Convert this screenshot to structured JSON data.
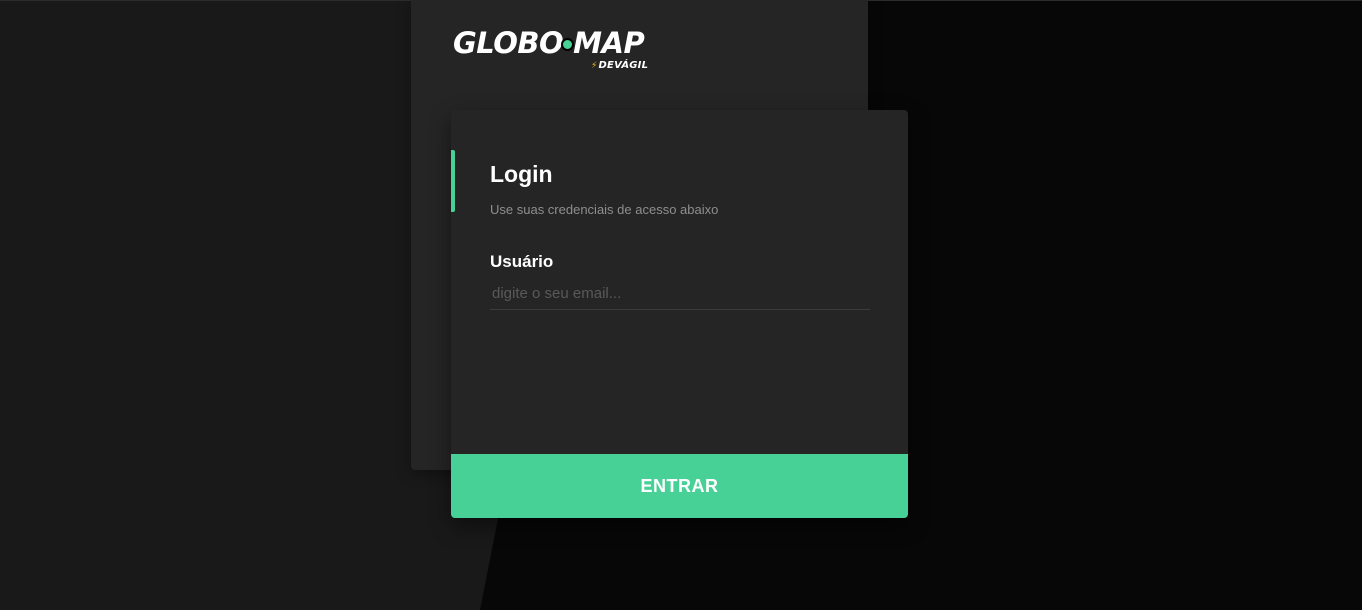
{
  "brand": {
    "logo_left": "GLOBO",
    "logo_right": "MAP",
    "logo_sub": "DEVÁGIL"
  },
  "login": {
    "title": "Login",
    "subtitle": "Use suas credenciais de acesso abaixo",
    "username_label": "Usuário",
    "username_placeholder": "digite o seu email...",
    "username_value": "",
    "submit_label": "ENTRAR"
  },
  "icons": {
    "logo_dot": "circle-dot-icon",
    "logo_bolt": "lightning-bolt-icon"
  },
  "colors": {
    "accent": "#48d197",
    "card_bg": "#252525",
    "page_bg": "#070707"
  }
}
